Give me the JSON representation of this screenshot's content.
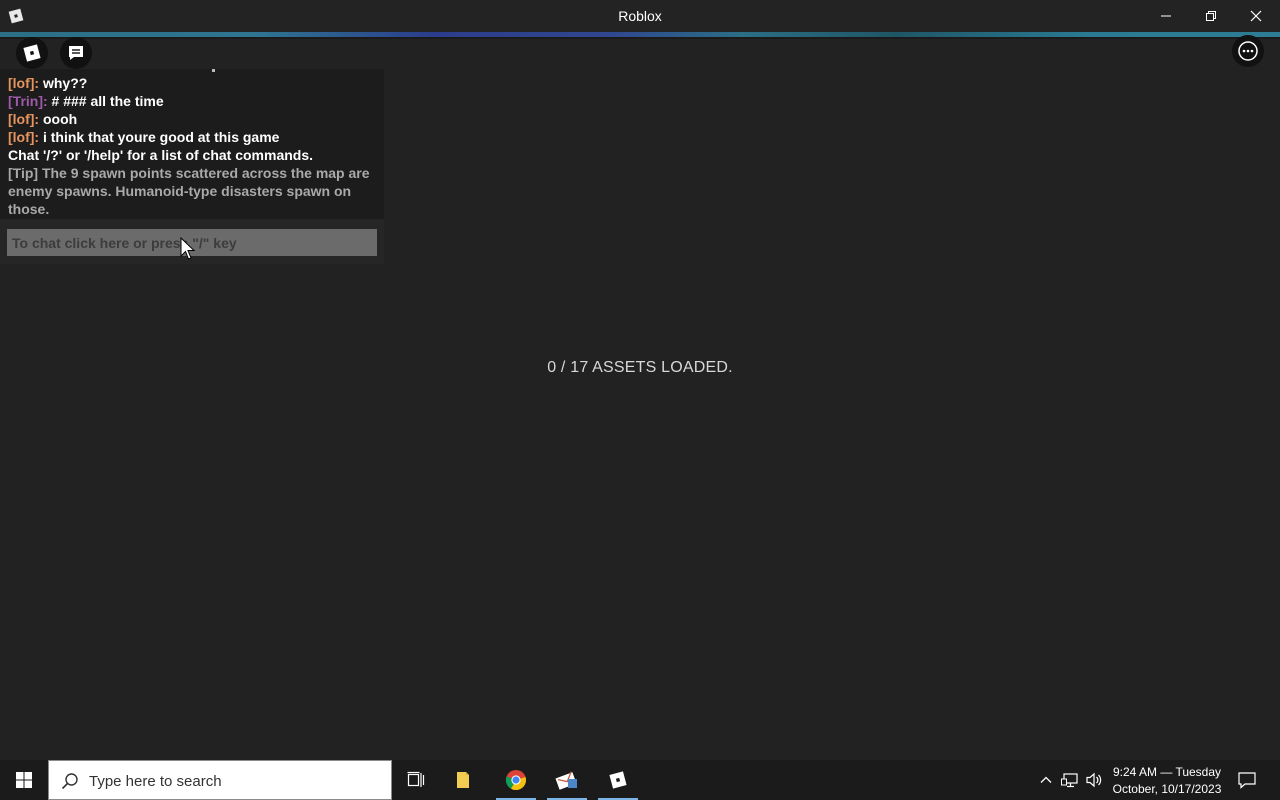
{
  "window": {
    "title": "Roblox"
  },
  "chat": {
    "messages": [
      {
        "name": "[lof]:",
        "text": "why??"
      },
      {
        "name": "[Trin]:",
        "text": "# ### all the time"
      },
      {
        "name": "[lof]:",
        "text": "oooh"
      },
      {
        "name": "[lof]:",
        "text": "i think that youre good at this game"
      }
    ],
    "system_message": "Chat '/?' or '/help' for a list of chat commands.",
    "tip": "[Tip] The 9 spawn points scattered across the map are enemy spawns. Humanoid-type disasters spawn on those.",
    "input_placeholder": "To chat click here or press \"/\" key"
  },
  "loading": {
    "text": "0 / 17 ASSETS LOADED."
  },
  "taskbar": {
    "search_placeholder": "Type here to search",
    "clock_time": "9:24 AM — Tuesday",
    "clock_date": "October, 10/17/2023"
  },
  "colors": {
    "background": "#222222",
    "name_lof": "#e8945e",
    "name_trin": "#9e5aa8",
    "tip_text": "#a9a9a9",
    "taskbar_active": "#7cb6e8"
  },
  "icons": [
    "roblox-logo-icon",
    "minimize-icon",
    "maximize-icon",
    "close-icon",
    "chat-icon",
    "more-icon",
    "mouse-cursor-icon",
    "windows-start-icon",
    "search-icon",
    "task-view-icon",
    "file-explorer-icon",
    "chrome-icon",
    "mail-app-icon",
    "roblox-app-icon",
    "chevron-up-icon",
    "network-icon",
    "volume-icon",
    "notification-icon"
  ]
}
